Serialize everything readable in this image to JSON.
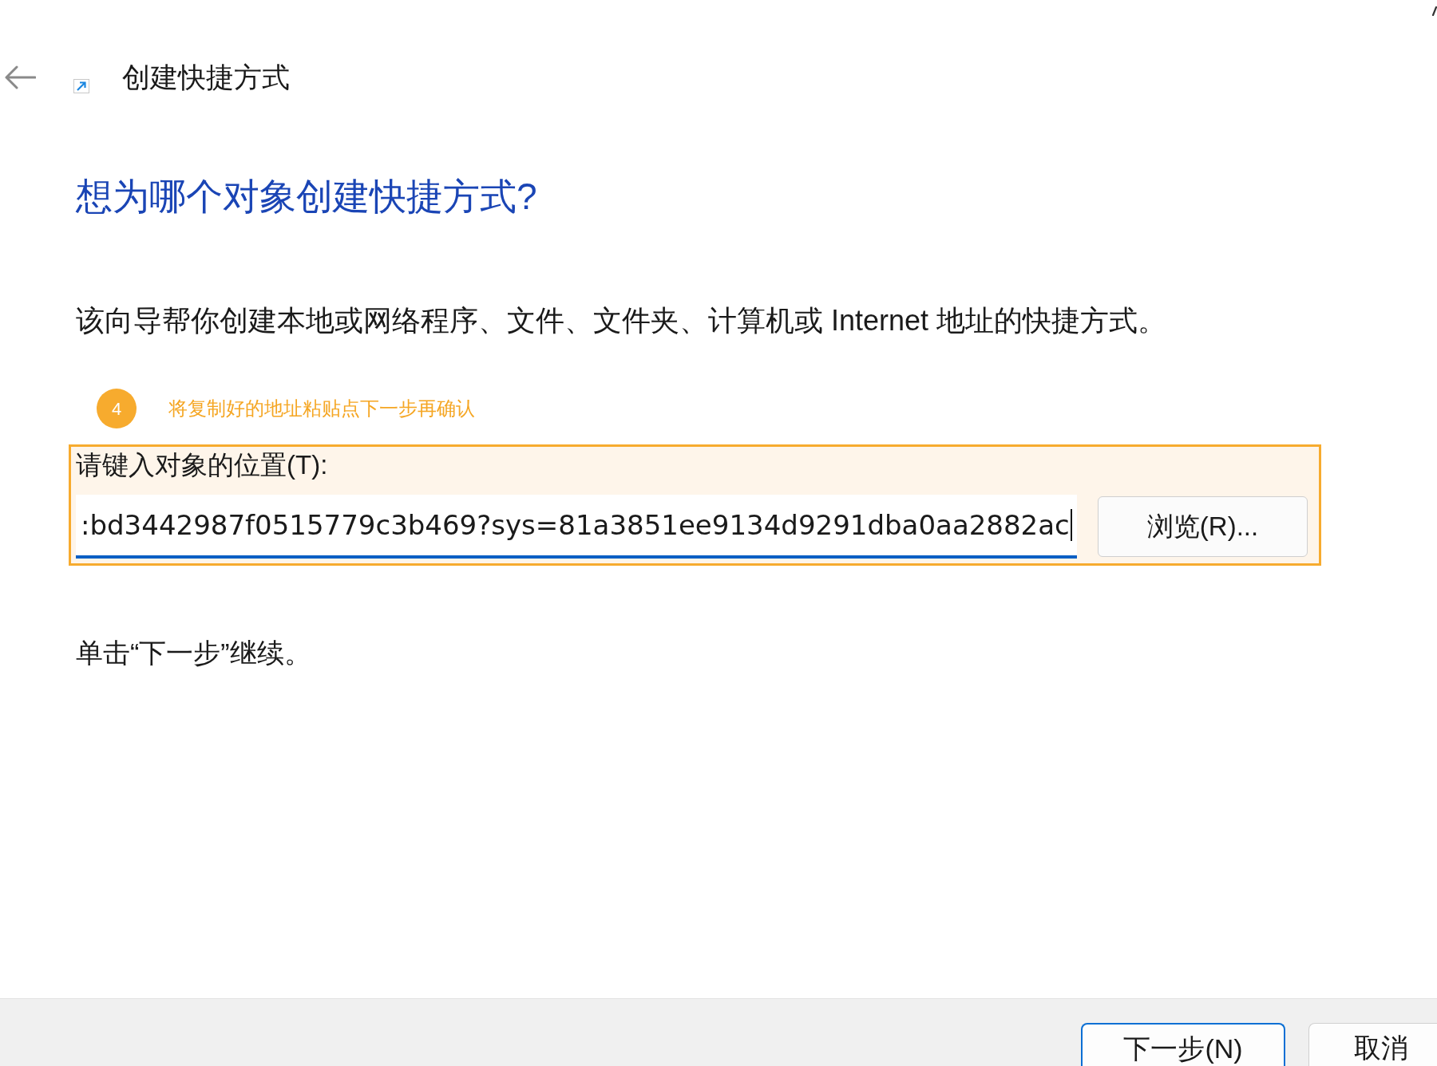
{
  "window": {
    "title": "创建快捷方式"
  },
  "heading": "想为哪个对象创建快捷方式?",
  "description": "该向导帮你创建本地或网络程序、文件、文件夹、计算机或 Internet 地址的快捷方式。",
  "annotation": {
    "number": "4",
    "text": "将复制好的地址粘贴点下一步再确认"
  },
  "location": {
    "label": "请键入对象的位置(T):",
    "value": ":bd3442987f0515779c3b469?sys=81a3851ee9134d9291dba0aa2882ac",
    "focused": true,
    "highlighted": true,
    "browse_button": "浏览(R)..."
  },
  "hint": "单击“下一步”继续。",
  "buttons": [
    {
      "label": "下一步(N)",
      "default": true
    },
    {
      "label": "取消",
      "default": false
    }
  ]
}
